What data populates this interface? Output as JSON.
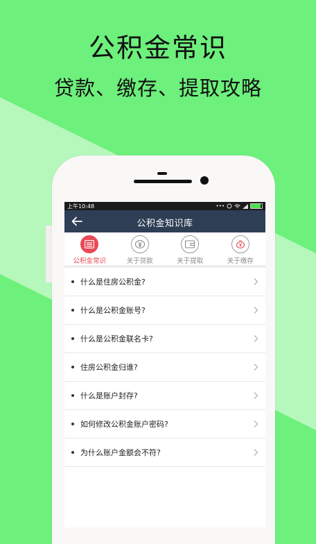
{
  "promo": {
    "headline": "公积金常识",
    "subheadline": "贷款、缴存、提取攻略"
  },
  "colors": {
    "background": "#6df07c",
    "navbar": "#2e3e55",
    "accent": "#e84a55"
  },
  "statusbar": {
    "time": "上午10:48",
    "icons": [
      "more-icon",
      "alarm-icon",
      "wifi-icon",
      "signal-icon",
      "battery-icon"
    ],
    "battery_level": 0.9
  },
  "navbar": {
    "back_icon": "arrow-left-icon",
    "title": "公积金知识库"
  },
  "tabs": [
    {
      "label": "公积金常识",
      "icon": "list-icon",
      "active": true
    },
    {
      "label": "关于贷款",
      "icon": "yen-coin-icon",
      "active": false
    },
    {
      "label": "关于提取",
      "icon": "wallet-icon",
      "active": false
    },
    {
      "label": "关于缴存",
      "icon": "piggy-bank-icon",
      "active": false
    }
  ],
  "faq": [
    "什么是住房公积金?",
    "什么是公积金账号?",
    "什么是公积金联名卡?",
    "住房公积金归谁?",
    "什么是账户封存?",
    "如何修改公积金账户密码?",
    "为什么账户金额会不符?"
  ]
}
